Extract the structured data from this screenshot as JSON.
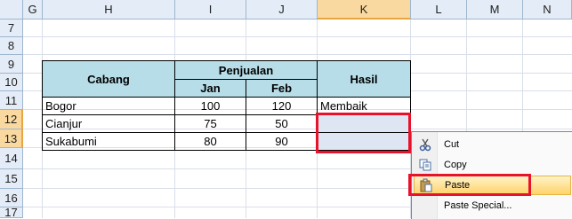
{
  "columns": [
    "G",
    "H",
    "I",
    "J",
    "K",
    "L",
    "M",
    "N"
  ],
  "rows": [
    "7",
    "8",
    "9",
    "10",
    "11",
    "12",
    "13",
    "14",
    "15",
    "16",
    "17"
  ],
  "selected_column": "K",
  "selected_rows": [
    "12",
    "13"
  ],
  "table": {
    "header": {
      "cabang": "Cabang",
      "penjualan": "Penjualan",
      "jan": "Jan",
      "feb": "Feb",
      "hasil": "Hasil"
    },
    "rows": [
      {
        "cabang": "Bogor",
        "jan": "100",
        "feb": "120",
        "hasil": "Membaik"
      },
      {
        "cabang": "Cianjur",
        "jan": "75",
        "feb": "50",
        "hasil": ""
      },
      {
        "cabang": "Sukabumi",
        "jan": "80",
        "feb": "90",
        "hasil": ""
      }
    ],
    "header_fill": "#b7dde8"
  },
  "context_menu": {
    "items": [
      {
        "label": "Cut",
        "icon": "scissors-icon"
      },
      {
        "label": "Copy",
        "icon": "copy-icon"
      },
      {
        "label": "Paste",
        "icon": "paste-icon",
        "highlighted": true
      },
      {
        "label": "Paste Special...",
        "icon": ""
      }
    ]
  },
  "highlight_color": "#e8132b"
}
